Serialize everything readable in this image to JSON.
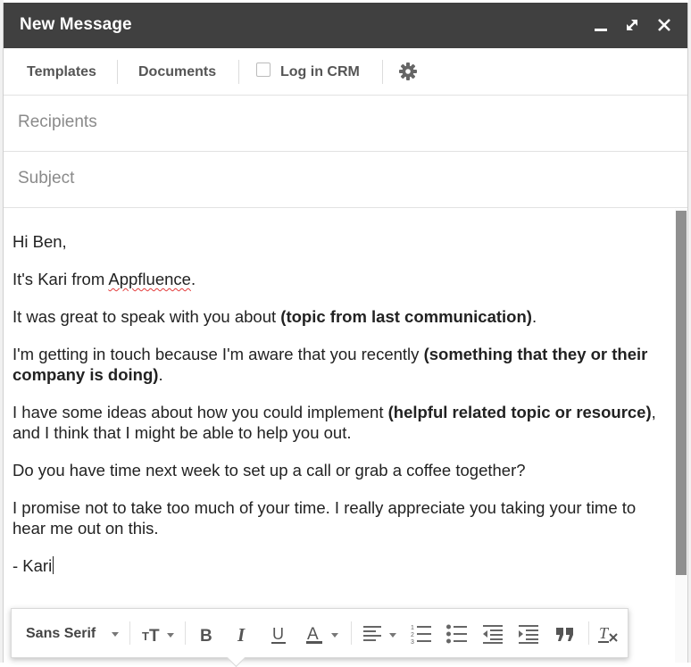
{
  "window": {
    "title": "New Message"
  },
  "toolbar": {
    "templates_label": "Templates",
    "documents_label": "Documents",
    "crm_label": "Log in CRM",
    "crm_checked": false
  },
  "fields": {
    "recipients_placeholder": "Recipients",
    "subject_placeholder": "Subject"
  },
  "body": {
    "greeting": "Hi Ben,",
    "intro_pre": "It's Kari from ",
    "intro_company": "Appfluence",
    "intro_post": ".",
    "p3_pre": "It was great to speak with you about ",
    "p3_bold": "(topic from last communication)",
    "p3_post": ".",
    "p4_pre": "I'm getting in touch because I'm aware that you recently ",
    "p4_bold": "(something that they or their company is doing)",
    "p4_post": ".",
    "p5_pre": "I have some ideas about how you could implement ",
    "p5_bold": "(helpful related topic or resource)",
    "p5_post": ", and I think that I might be able to help you out.",
    "p6": "Do you have time next week to set up a call or grab a coffee together?",
    "p7": "I promise not to take too much of your time. I really appreciate you taking your time to hear me out on this.",
    "signature": "- Kari"
  },
  "format_bar": {
    "font": "Sans Serif",
    "icons": [
      "text-size-icon",
      "bold-icon",
      "italic-icon",
      "underline-icon",
      "text-color-icon",
      "align-icon",
      "numbered-list-icon",
      "bulleted-list-icon",
      "indent-less-icon",
      "indent-more-icon",
      "quote-icon",
      "remove-formatting-icon"
    ]
  },
  "colors": {
    "titlebar": "#404040",
    "scroll_thumb": "#8f8f8f"
  }
}
